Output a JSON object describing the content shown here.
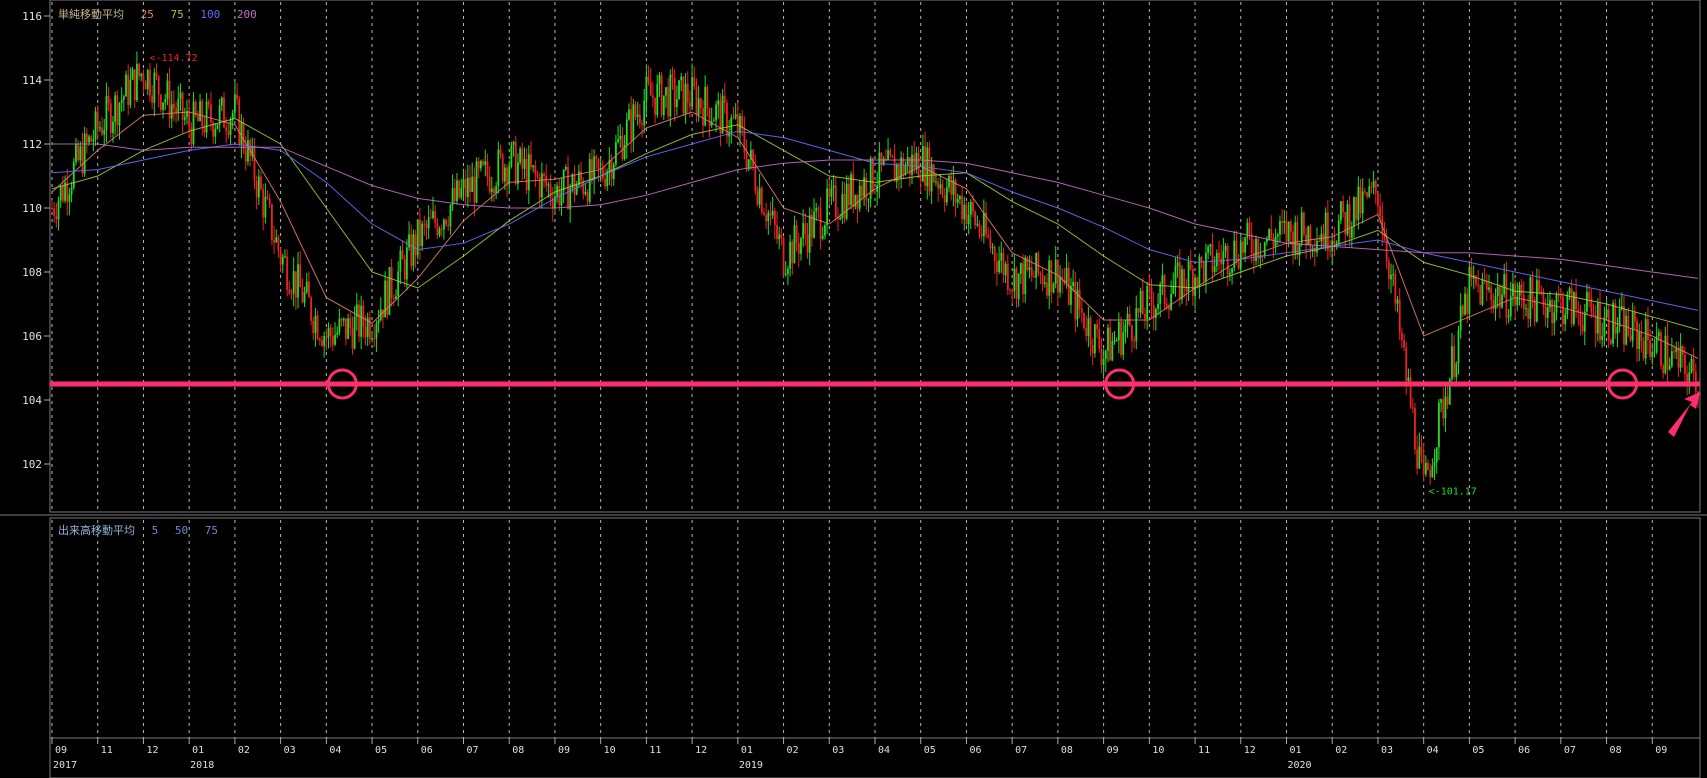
{
  "price_panel": {
    "indicator_name": "単純移動平均",
    "ma_periods": [
      {
        "label": "25",
        "color": "#e07a6a"
      },
      {
        "label": "75",
        "color": "#9acd32"
      },
      {
        "label": "100",
        "color": "#6a6aff"
      },
      {
        "label": "200",
        "color": "#c070c0"
      }
    ],
    "high_marker": "<-114.72",
    "low_marker": "<-101.17"
  },
  "volume_panel": {
    "indicator_name": "出来高移動平均",
    "ma_periods": [
      {
        "label": "5",
        "color": "#6a8ad0"
      },
      {
        "label": "50",
        "color": "#6a8ad0"
      },
      {
        "label": "75",
        "color": "#6a8ad0"
      }
    ]
  },
  "chart_data": {
    "type": "candlestick",
    "title": "",
    "y_ticks": [
      "116",
      "114",
      "112",
      "110",
      "108",
      "106",
      "104",
      "102"
    ],
    "ylim": [
      100.5,
      116.5
    ],
    "x_month_labels": [
      "09",
      "11",
      "12",
      "01",
      "02",
      "03",
      "04",
      "05",
      "06",
      "07",
      "08",
      "09",
      "10",
      "11",
      "12",
      "01",
      "02",
      "03",
      "04",
      "05",
      "06",
      "07",
      "08",
      "09",
      "10",
      "11",
      "12",
      "01",
      "02",
      "03",
      "04",
      "05",
      "06",
      "07",
      "08",
      "09"
    ],
    "x_year_labels": [
      "2017",
      "2018",
      "2019",
      "2020"
    ],
    "high_point": {
      "value": 114.72,
      "period": "2017-11"
    },
    "low_point": {
      "value": 101.17,
      "period": "2020-03"
    },
    "support_line": {
      "value": 104.5,
      "color": "#ff2e6e"
    },
    "support_touches": [
      "2018-03",
      "2019-08",
      "2020-07"
    ],
    "close_path": [
      {
        "period": "2017-09",
        "value": 110.0
      },
      {
        "period": "2017-10",
        "value": 112.5
      },
      {
        "period": "2017-11",
        "value": 114.3
      },
      {
        "period": "2017-12",
        "value": 112.6
      },
      {
        "period": "2018-01",
        "value": 113.0
      },
      {
        "period": "2018-02",
        "value": 108.5
      },
      {
        "period": "2018-03",
        "value": 106.0
      },
      {
        "period": "2018-04",
        "value": 106.5
      },
      {
        "period": "2018-05",
        "value": 109.0
      },
      {
        "period": "2018-06",
        "value": 110.5
      },
      {
        "period": "2018-07",
        "value": 111.5
      },
      {
        "period": "2018-08",
        "value": 110.5
      },
      {
        "period": "2018-09",
        "value": 111.0
      },
      {
        "period": "2018-10",
        "value": 113.5
      },
      {
        "period": "2018-11",
        "value": 113.5
      },
      {
        "period": "2018-12",
        "value": 112.5
      },
      {
        "period": "2019-01",
        "value": 108.5
      },
      {
        "period": "2019-02",
        "value": 110.0
      },
      {
        "period": "2019-03",
        "value": 111.0
      },
      {
        "period": "2019-04",
        "value": 111.5
      },
      {
        "period": "2019-05",
        "value": 110.0
      },
      {
        "period": "2019-06",
        "value": 107.8
      },
      {
        "period": "2019-07",
        "value": 108.0
      },
      {
        "period": "2019-08",
        "value": 105.5
      },
      {
        "period": "2019-09",
        "value": 107.0
      },
      {
        "period": "2019-10",
        "value": 108.0
      },
      {
        "period": "2019-11",
        "value": 108.8
      },
      {
        "period": "2019-12",
        "value": 109.2
      },
      {
        "period": "2020-01",
        "value": 109.3
      },
      {
        "period": "2020-02",
        "value": 110.5
      },
      {
        "period": "2020-03",
        "value": 101.2
      },
      {
        "period": "2020-04",
        "value": 107.5
      },
      {
        "period": "2020-05",
        "value": 107.2
      },
      {
        "period": "2020-06",
        "value": 107.0
      },
      {
        "period": "2020-07",
        "value": 106.5
      },
      {
        "period": "2020-08",
        "value": 105.8
      },
      {
        "period": "2020-09",
        "value": 104.6
      }
    ],
    "ma_series": [
      {
        "name": "25",
        "values": [
          110.5,
          111.8,
          112.9,
          113.0,
          112.6,
          110.2,
          107.2,
          106.4,
          107.8,
          109.6,
          110.8,
          110.9,
          111.2,
          112.5,
          113.0,
          112.2,
          110.0,
          109.5,
          110.6,
          111.3,
          110.6,
          108.6,
          107.9,
          106.5,
          106.5,
          107.5,
          108.4,
          108.9,
          109.1,
          109.8,
          106.0,
          106.6,
          107.2,
          106.9,
          106.5,
          106.0,
          105.3
        ]
      },
      {
        "name": "75",
        "values": [
          110.6,
          111.0,
          111.8,
          112.4,
          112.8,
          112.0,
          110.0,
          108.0,
          107.5,
          108.5,
          109.6,
          110.5,
          111.0,
          111.7,
          112.3,
          112.6,
          111.8,
          111.0,
          110.8,
          111.0,
          111.1,
          110.2,
          109.5,
          108.5,
          107.6,
          107.5,
          108.0,
          108.5,
          108.8,
          109.3,
          108.3,
          107.9,
          107.4,
          107.3,
          107.0,
          106.6,
          106.2
        ]
      },
      {
        "name": "100",
        "values": [
          111.1,
          111.2,
          111.5,
          111.8,
          112.0,
          111.8,
          110.8,
          109.5,
          108.7,
          108.9,
          109.5,
          110.3,
          111.0,
          111.6,
          112.0,
          112.4,
          112.2,
          111.8,
          111.4,
          111.3,
          111.1,
          110.5,
          110.0,
          109.4,
          108.7,
          108.3,
          108.4,
          108.6,
          108.8,
          109.0,
          108.6,
          108.3,
          108.0,
          107.7,
          107.4,
          107.1,
          106.8
        ]
      },
      {
        "name": "200",
        "values": [
          112.0,
          112.0,
          111.8,
          111.9,
          111.9,
          111.9,
          111.3,
          110.7,
          110.3,
          110.1,
          110.0,
          110.0,
          110.1,
          110.4,
          110.8,
          111.2,
          111.4,
          111.5,
          111.5,
          111.5,
          111.4,
          111.1,
          110.8,
          110.4,
          110.0,
          109.5,
          109.2,
          108.9,
          108.8,
          108.7,
          108.6,
          108.6,
          108.5,
          108.4,
          108.2,
          108.0,
          107.8
        ]
      }
    ]
  }
}
